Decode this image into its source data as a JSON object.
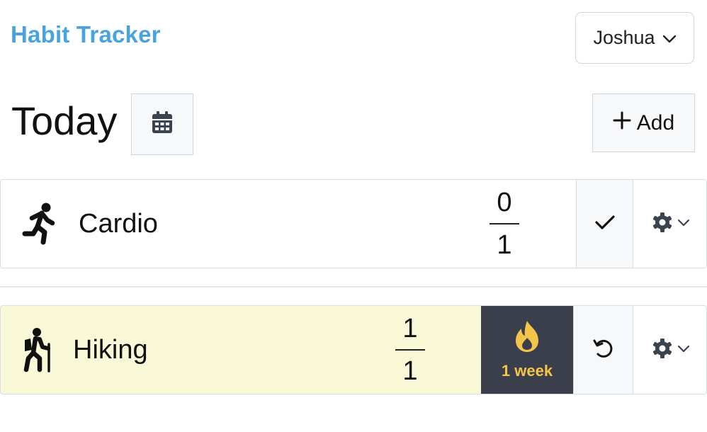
{
  "header": {
    "brand": "Habit Tracker",
    "user_name": "Joshua"
  },
  "page": {
    "title": "Today",
    "add_label": "Add"
  },
  "habits": [
    {
      "name": "Cardio",
      "icon": "running-icon",
      "done": "0",
      "goal": "1",
      "action": "check"
    },
    {
      "name": "Hiking",
      "icon": "hiking-icon",
      "done": "1",
      "goal": "1",
      "streak": "1 week",
      "action": "undo"
    }
  ],
  "colors": {
    "brand": "#4aa3df",
    "streak_bg": "#3a3f4b",
    "streak_fg": "#f3c64a",
    "complete_row_bg": "#f9f9d7"
  }
}
